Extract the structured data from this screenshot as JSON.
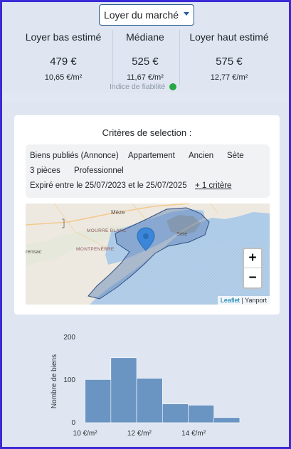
{
  "rent_type": {
    "label": "Loyer du marché",
    "caret": "chevron-down-icon"
  },
  "estimates": {
    "low": {
      "label": "Loyer bas estimé",
      "value": "479 €",
      "per_sqm": "10,65 €/m²"
    },
    "median": {
      "label": "Médiane",
      "value": "525 €",
      "per_sqm": "11,67 €/m²"
    },
    "high": {
      "label": "Loyer haut estimé",
      "value": "575 €",
      "per_sqm": "12,77 €/m²"
    },
    "reliability_label": "Indice de fiabilité",
    "reliability_color": "#28a745"
  },
  "criteria": {
    "title": "Critères de selection :",
    "tags": [
      "Biens publiés (Annonce)",
      "Appartement",
      "Ancien",
      "Sète",
      "3 pièces",
      "Professionnel",
      "Expiré entre le 25/07/2023 et le 25/07/2025"
    ],
    "more_link": "+ 1 critère"
  },
  "map": {
    "labels": [
      "Mèze",
      "MOURRE BLANC",
      "MONTPENÈBRE",
      "rensac",
      "Sète"
    ],
    "zoom_in": "+",
    "zoom_out": "−",
    "attribution_leaflet": "Leaflet",
    "attribution_sep": " | ",
    "attribution_provider": "Yanport",
    "area_color": "#5b7fb5",
    "marker_color": "#3b86d8"
  },
  "chart_data": {
    "type": "bar",
    "title": "",
    "xlabel": "",
    "ylabel": "Nombre de biens",
    "bar_color": "#6a94c2",
    "bins": [
      {
        "from": 10.0,
        "to": 10.95,
        "value": 101
      },
      {
        "from": 10.95,
        "to": 11.9,
        "value": 152
      },
      {
        "from": 11.9,
        "to": 12.85,
        "value": 104
      },
      {
        "from": 12.85,
        "to": 13.8,
        "value": 44
      },
      {
        "from": 13.8,
        "to": 14.75,
        "value": 41
      },
      {
        "from": 14.75,
        "to": 15.7,
        "value": 12
      }
    ],
    "xlim": [
      9.8,
      16.2
    ],
    "ylim": [
      0,
      200
    ],
    "yticks": [
      0,
      100,
      200
    ],
    "xticks": [
      10,
      12,
      14
    ],
    "xtick_labels": [
      "10 €/m²",
      "12 €/m²",
      "14 €/m²"
    ]
  }
}
